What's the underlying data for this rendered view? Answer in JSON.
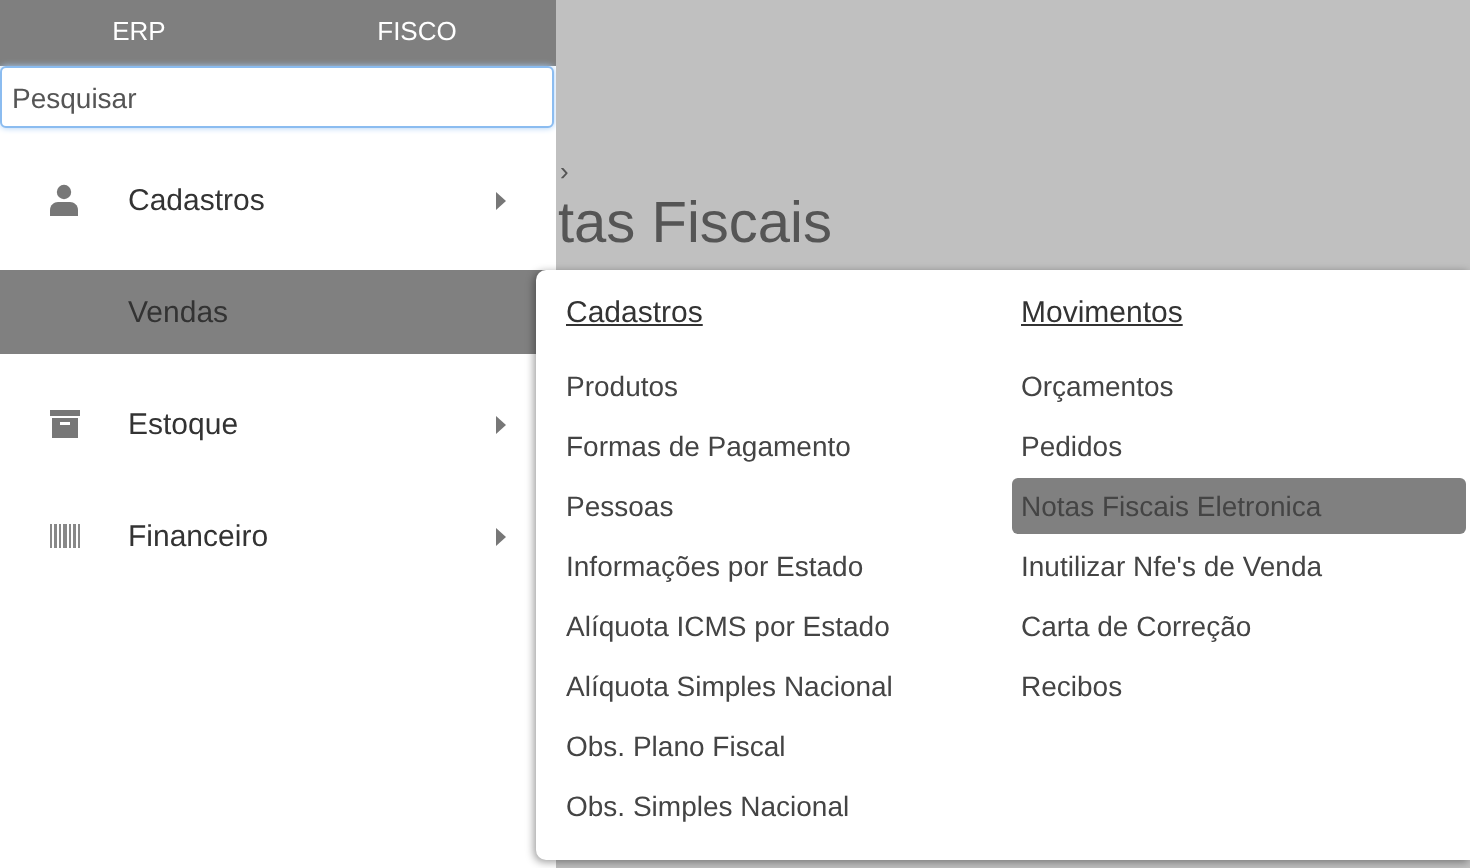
{
  "sidebar": {
    "tabs": [
      {
        "label": "ERP"
      },
      {
        "label": "FISCO"
      }
    ],
    "search": {
      "placeholder": "Pesquisar"
    },
    "items": [
      {
        "label": "Cadastros",
        "selected": false,
        "has_submenu": true
      },
      {
        "label": "Vendas",
        "selected": true,
        "has_submenu": false
      },
      {
        "label": "Estoque",
        "selected": false,
        "has_submenu": true
      },
      {
        "label": "Financeiro",
        "selected": false,
        "has_submenu": true
      }
    ]
  },
  "page": {
    "breadcrumb": "›",
    "title": "tas Fiscais"
  },
  "flyout": {
    "columns": [
      {
        "heading": "Cadastros",
        "items": [
          {
            "label": "Produtos",
            "selected": false
          },
          {
            "label": "Formas de Pagamento",
            "selected": false
          },
          {
            "label": "Pessoas",
            "selected": false
          },
          {
            "label": "Informações por Estado",
            "selected": false
          },
          {
            "label": "Alíquota ICMS por Estado",
            "selected": false
          },
          {
            "label": "Alíquota Simples Nacional",
            "selected": false
          },
          {
            "label": "Obs. Plano Fiscal",
            "selected": false
          },
          {
            "label": "Obs. Simples Nacional",
            "selected": false
          }
        ]
      },
      {
        "heading": "Movimentos",
        "items": [
          {
            "label": "Orçamentos",
            "selected": false
          },
          {
            "label": "Pedidos",
            "selected": false
          },
          {
            "label": "Notas Fiscais Eletronica",
            "selected": true
          },
          {
            "label": "Inutilizar Nfe's de Venda",
            "selected": false
          },
          {
            "label": "Carta de Correção",
            "selected": false
          },
          {
            "label": "Recibos",
            "selected": false
          }
        ]
      }
    ]
  }
}
